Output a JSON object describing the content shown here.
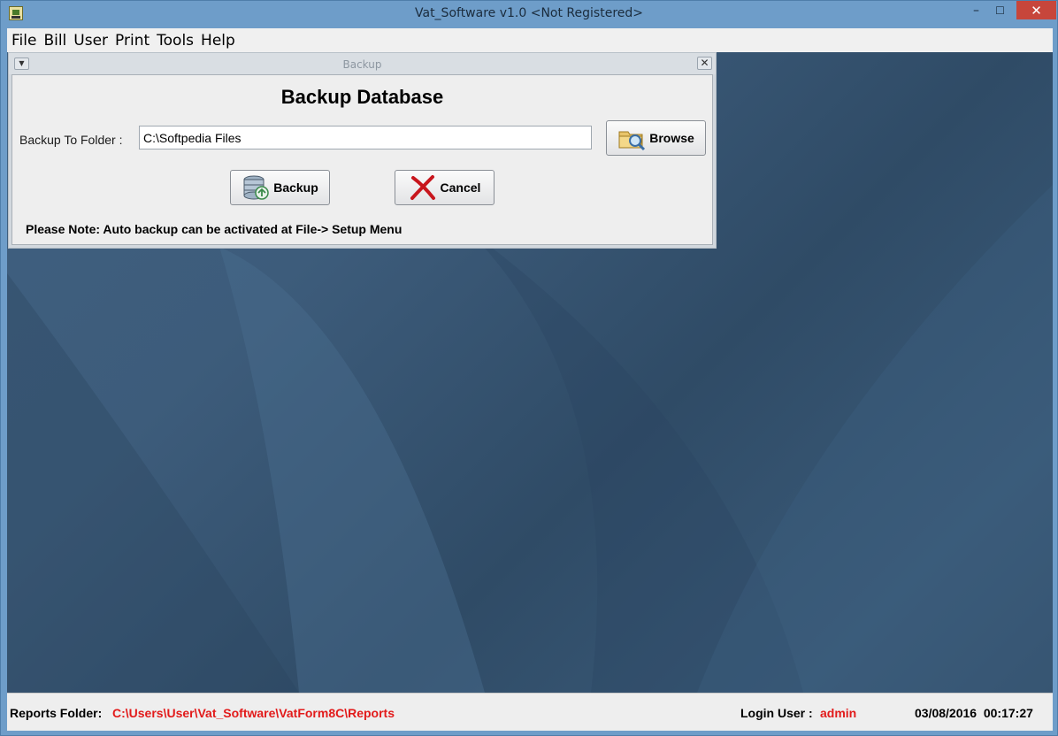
{
  "window": {
    "title": "Vat_Software v1.0 <Not Registered>",
    "controls": {
      "minimize": "–",
      "maximize": "☐",
      "close": "✕"
    }
  },
  "menubar": {
    "items": [
      "File",
      "Bill",
      "User",
      "Print",
      "Tools",
      "Help"
    ]
  },
  "backup_frame": {
    "title": "Backup",
    "menu_glyph": "▼",
    "close_glyph": "✕",
    "heading": "Backup Database",
    "folder_label": "Backup To Folder :",
    "folder_value": "C:\\Softpedia Files",
    "browse_label": "Browse",
    "backup_label": "Backup",
    "cancel_label": "Cancel",
    "note": "Please Note: Auto backup can be activated at File-> Setup Menu",
    "icons": {
      "browse": "folder-search-icon",
      "backup": "database-backup-icon",
      "cancel": "red-x-icon"
    }
  },
  "statusbar": {
    "reports_label": "Reports Folder:",
    "reports_value": "C:\\Users\\User\\Vat_Software\\VatForm8C\\Reports",
    "login_label": "Login User :",
    "login_value": "admin",
    "datetime": "03/08/2016  00:17:27"
  },
  "colors": {
    "title_bar": "#6e9dc9",
    "close_button": "#c7463b",
    "status_value": "#e21a1a",
    "desktop": "#3d5c7b"
  }
}
